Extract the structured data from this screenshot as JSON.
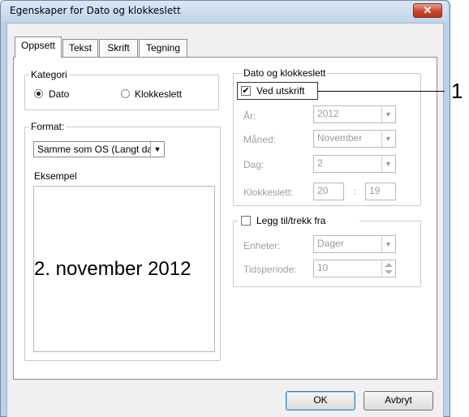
{
  "window": {
    "title": "Egenskaper for Dato og klokkeslett",
    "close_label": "✕"
  },
  "tabs": [
    {
      "label": "Oppsett",
      "active": true
    },
    {
      "label": "Tekst",
      "active": false
    },
    {
      "label": "Skrift",
      "active": false
    },
    {
      "label": "Tegning",
      "active": false
    }
  ],
  "kategori": {
    "label": "Kategori",
    "options": [
      "Dato",
      "Klokkeslett"
    ],
    "selected": "Dato"
  },
  "format": {
    "label": "Format:",
    "value": "Samme som OS (Langt da",
    "sample_label": "Eksempel",
    "sample_value": "2. november 2012"
  },
  "datetime": {
    "label": "Dato og klokkeslett",
    "print_checkbox": {
      "label": "Ved utskrift",
      "checked": true
    },
    "fields": {
      "year_label": "År:",
      "year_value": "2012",
      "month_label": "Måned:",
      "month_value": "November",
      "day_label": "Dag:",
      "day_value": "2",
      "time_label": "Klokkeslett:",
      "hour_value": "20",
      "time_sep": ":",
      "minute_value": "19"
    }
  },
  "offset": {
    "checkbox": {
      "label": "Legg til/trekk fra",
      "checked": false
    },
    "unit_label": "Enheter:",
    "unit_value": "Dager",
    "period_label": "Tidsperiode:",
    "period_value": "10"
  },
  "buttons": {
    "ok": "OK",
    "cancel": "Avbryt"
  },
  "callout": {
    "number": "1"
  },
  "icons": {
    "close": "close-icon",
    "radio": "radio-icon",
    "checkbox": "checkbox-icon",
    "dropdown": "chevron-down-icon",
    "spinner": "spinner-icon"
  },
  "colors": {
    "title_bg": "#c2d5ec",
    "close_bg": "#c84a30",
    "frame": "#bcd0e6"
  }
}
